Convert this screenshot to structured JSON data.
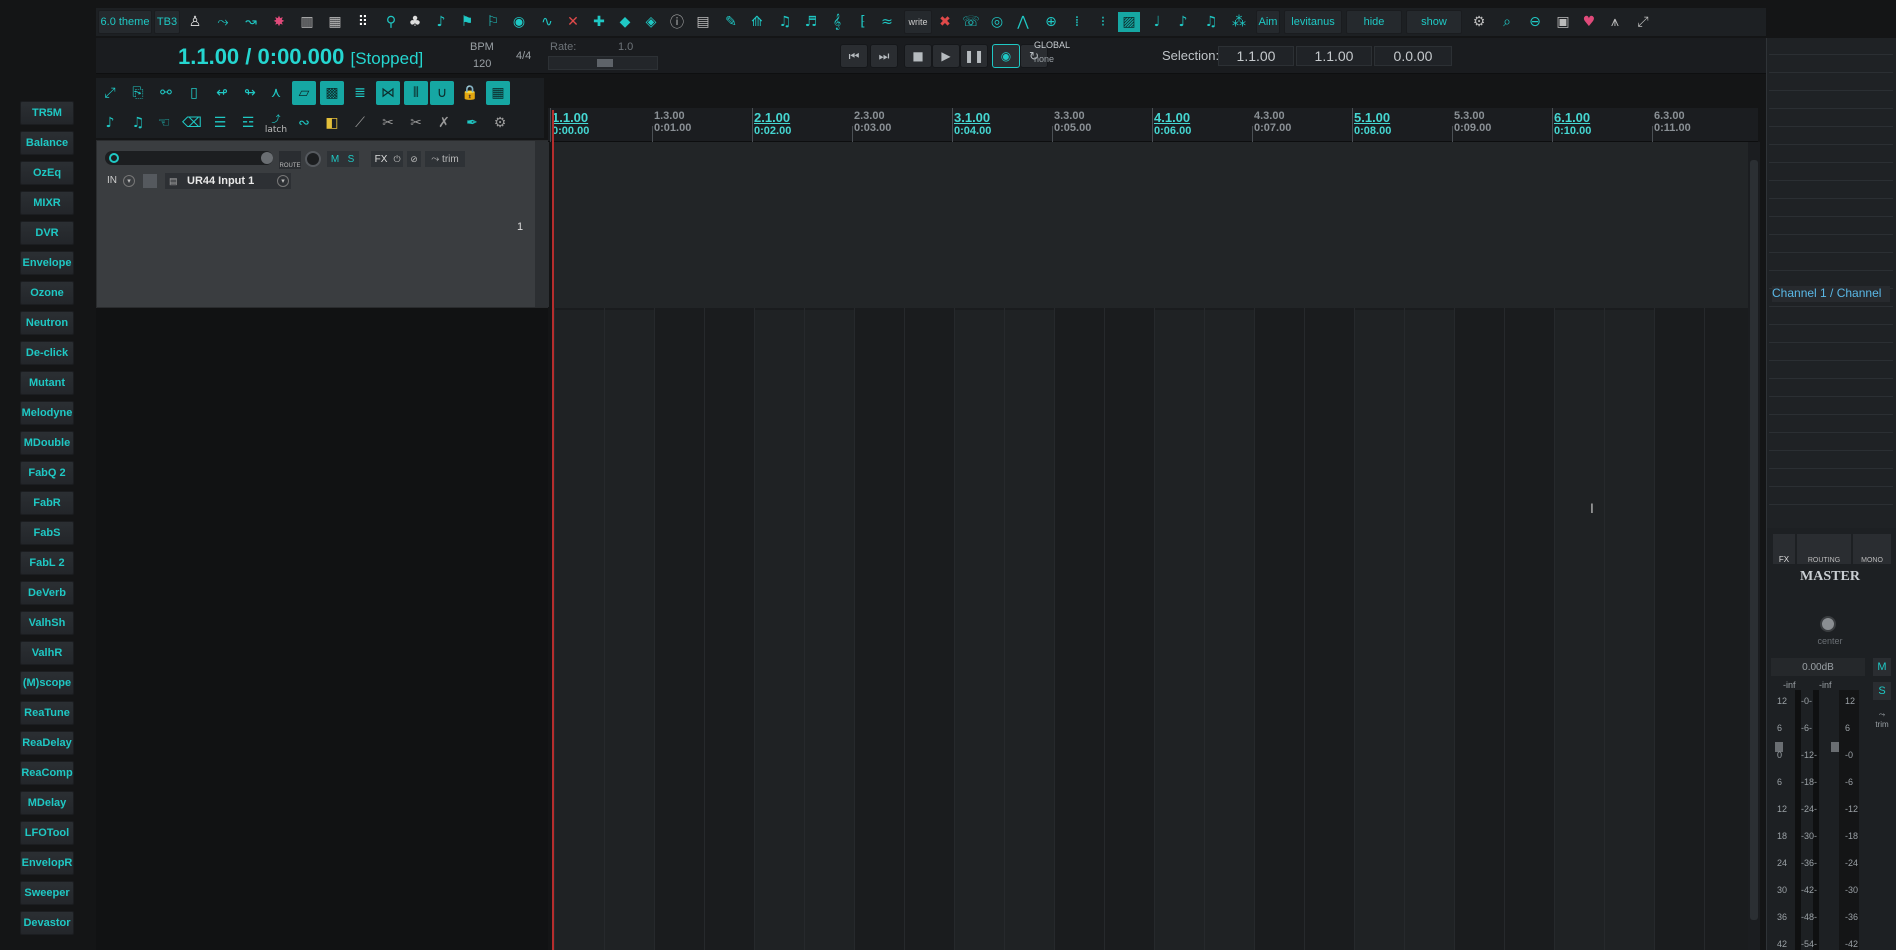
{
  "launcher": {
    "items": [
      "TR5M",
      "Balance",
      "OzEq",
      "MIXR",
      "DVR",
      "Envelope",
      "Ozone",
      "Neutron",
      "De-click",
      "Mutant",
      "Melodyne",
      "MDouble",
      "FabQ 2",
      "FabR",
      "FabS",
      "FabL 2",
      "DeVerb",
      "ValhSh",
      "ValhR",
      "(M)scope",
      "ReaTune",
      "ReaDelay",
      "ReaComp",
      "MDelay",
      "LFOTool",
      "EnvelopR",
      "Sweeper",
      "Devastor"
    ]
  },
  "toolbar": {
    "theme_label": "6.0 theme",
    "tb3_label": "TB3",
    "write_label": "write",
    "aim_label": "Aim",
    "user_label": "levitanus",
    "hide_label": "hide",
    "show_label": "show"
  },
  "transport": {
    "position": "1.1.00 / 0:00.000",
    "state": "[Stopped]",
    "bpm_label": "BPM",
    "bpm_value": "120",
    "time_sig": "4/4",
    "rate_label": "Rate:",
    "rate_value": "1.0",
    "global_label": "GLOBAL",
    "global_mode": "none",
    "selection_label": "Selection:",
    "sel_start": "1.1.00",
    "sel_end": "1.1.00",
    "sel_len": "0.0.00"
  },
  "toolbar2": {
    "latch_label": "latch",
    "trim_label": "trim"
  },
  "track": {
    "input_label": "IN",
    "input_name": "UR44 Input 1",
    "route_label": "ROUTE",
    "mute_label": "M",
    "solo_label": "S",
    "fx_label": "FX",
    "number": "1"
  },
  "ruler": {
    "marks": [
      {
        "bar": "1.1.00",
        "sec": "0:00.00",
        "major": true
      },
      {
        "bar": "1.3.00",
        "sec": "0:01.00",
        "major": false
      },
      {
        "bar": "2.1.00",
        "sec": "0:02.00",
        "major": true
      },
      {
        "bar": "2.3.00",
        "sec": "0:03.00",
        "major": false
      },
      {
        "bar": "3.1.00",
        "sec": "0:04.00",
        "major": true
      },
      {
        "bar": "3.3.00",
        "sec": "0:05.00",
        "major": false
      },
      {
        "bar": "4.1.00",
        "sec": "0:06.00",
        "major": true
      },
      {
        "bar": "4.3.00",
        "sec": "0:07.00",
        "major": false
      },
      {
        "bar": "5.1.00",
        "sec": "0:08.00",
        "major": true
      },
      {
        "bar": "5.3.00",
        "sec": "0:09.00",
        "major": false
      },
      {
        "bar": "6.1.00",
        "sec": "0:10.00",
        "major": true
      },
      {
        "bar": "6.3.00",
        "sec": "0:11.00",
        "major": false
      }
    ]
  },
  "mixer": {
    "channel_label": "Channel 1 / Channel",
    "fx_label": "FX",
    "routing_label": "ROUTING",
    "mono_label": "MONO",
    "mute_label": "M",
    "solo_label": "S",
    "master_label": "MASTER",
    "pan_label": "center",
    "volume_label": "0.00dB",
    "peak_left": "-inf",
    "peak_right": "-inf",
    "trim_label": "trim",
    "scale_left": [
      "12",
      "6",
      "0",
      "6",
      "12",
      "18",
      "24",
      "30",
      "36",
      "42"
    ],
    "scale_mid": [
      "-0-",
      "-6-",
      "-12-",
      "-18-",
      "-24-",
      "-30-",
      "-36-",
      "-42-",
      "-48-",
      "-54-"
    ],
    "scale_right": [
      "12",
      "6",
      "-0",
      "-6",
      "-12",
      "-18",
      "-24",
      "-30",
      "-36",
      "-42"
    ]
  },
  "colors": {
    "accent": "#1fc8c4",
    "background": "#141516",
    "cursor": "#b52d2d"
  }
}
